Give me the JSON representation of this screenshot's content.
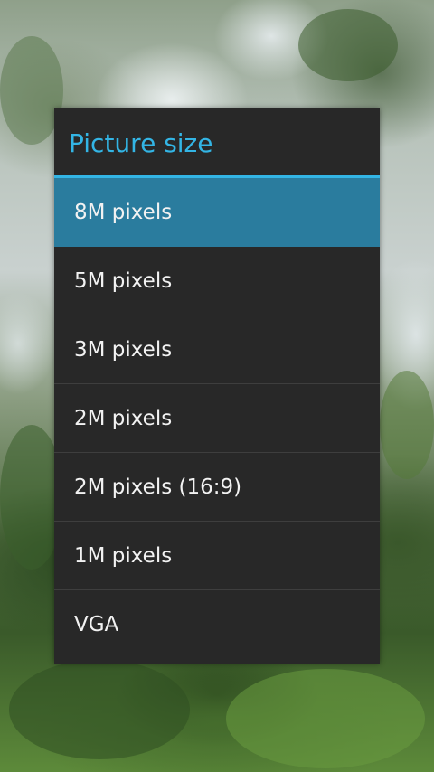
{
  "dialog": {
    "title": "Picture size",
    "options": [
      {
        "label": "8M pixels",
        "selected": true
      },
      {
        "label": "5M pixels",
        "selected": false
      },
      {
        "label": "3M pixels",
        "selected": false
      },
      {
        "label": "2M pixels",
        "selected": false
      },
      {
        "label": "2M pixels (16:9)",
        "selected": false
      },
      {
        "label": "1M pixels",
        "selected": false
      },
      {
        "label": "VGA",
        "selected": false
      }
    ]
  },
  "colors": {
    "accent": "#33b5e5",
    "selected_background": "#2a7c9e",
    "dialog_background": "#282828",
    "option_text": "#f2f2f2"
  }
}
